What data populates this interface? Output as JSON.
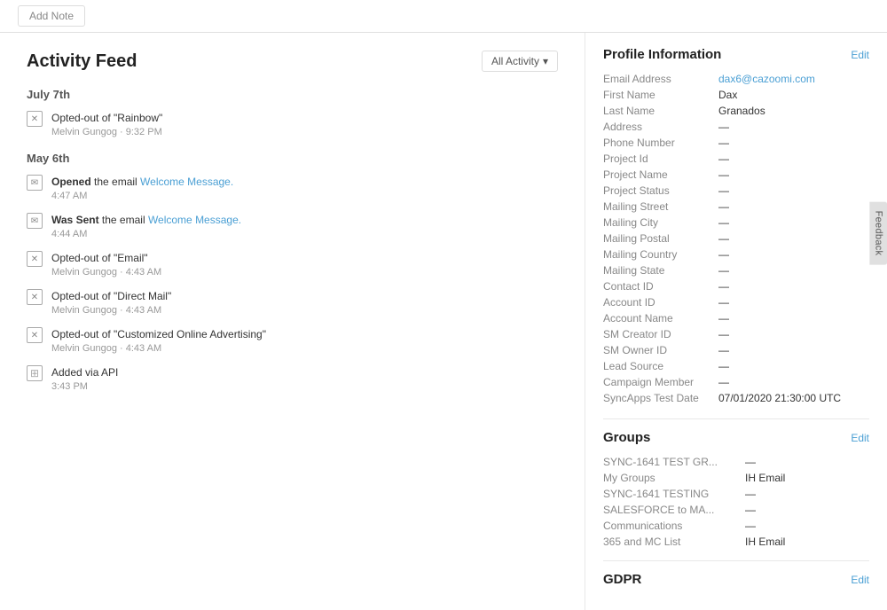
{
  "topbar": {
    "add_note_label": "Add Note"
  },
  "activity": {
    "title": "Activity Feed",
    "filter_label": "All Activity",
    "sections": [
      {
        "date": "July 7th",
        "items": [
          {
            "icon": "x",
            "text_parts": [
              {
                "type": "plain",
                "text": "Opted-out of \"Rainbow\""
              }
            ],
            "meta": "Melvin Gungog · 9:32 PM"
          }
        ]
      },
      {
        "date": "May 6th",
        "items": [
          {
            "icon": "envelope",
            "text_parts": [
              {
                "type": "bold",
                "text": "Opened"
              },
              {
                "type": "plain",
                "text": " the email "
              },
              {
                "type": "link",
                "text": "Welcome Message."
              }
            ],
            "meta": "4:47 AM"
          },
          {
            "icon": "envelope",
            "text_parts": [
              {
                "type": "bold",
                "text": "Was Sent"
              },
              {
                "type": "plain",
                "text": " the email "
              },
              {
                "type": "link",
                "text": "Welcome Message."
              }
            ],
            "meta": "4:44 AM"
          },
          {
            "icon": "x",
            "text_parts": [
              {
                "type": "plain",
                "text": "Opted-out of \"Email\""
              }
            ],
            "meta": "Melvin Gungog · 4:43 AM"
          },
          {
            "icon": "x",
            "text_parts": [
              {
                "type": "plain",
                "text": "Opted-out of \"Direct Mail\""
              }
            ],
            "meta": "Melvin Gungog · 4:43 AM"
          },
          {
            "icon": "x",
            "text_parts": [
              {
                "type": "plain",
                "text": "Opted-out of \"Customized Online Advertising\""
              }
            ],
            "meta": "Melvin Gungog · 4:43 AM"
          },
          {
            "icon": "plus",
            "text_parts": [
              {
                "type": "plain",
                "text": "Added via API"
              }
            ],
            "meta": "3:43 PM"
          }
        ]
      }
    ]
  },
  "profile": {
    "section_title": "Profile Information",
    "edit_label": "Edit",
    "fields": [
      {
        "label": "Email Address",
        "value": "dax6@cazoomi.com",
        "type": "email"
      },
      {
        "label": "First Name",
        "value": "Dax",
        "type": "text"
      },
      {
        "label": "Last Name",
        "value": "Granados",
        "type": "text"
      },
      {
        "label": "Address",
        "value": "—",
        "type": "dash"
      },
      {
        "label": "Phone Number",
        "value": "—",
        "type": "dash"
      },
      {
        "label": "Project Id",
        "value": "—",
        "type": "dash"
      },
      {
        "label": "Project Name",
        "value": "—",
        "type": "dash"
      },
      {
        "label": "Project Status",
        "value": "—",
        "type": "dash"
      },
      {
        "label": "Mailing Street",
        "value": "—",
        "type": "dash"
      },
      {
        "label": "Mailing City",
        "value": "—",
        "type": "dash"
      },
      {
        "label": "Mailing Postal",
        "value": "—",
        "type": "dash"
      },
      {
        "label": "Mailing Country",
        "value": "—",
        "type": "dash"
      },
      {
        "label": "Mailing State",
        "value": "—",
        "type": "dash"
      },
      {
        "label": "Contact ID",
        "value": "—",
        "type": "dash"
      },
      {
        "label": "Account ID",
        "value": "—",
        "type": "dash"
      },
      {
        "label": "Account Name",
        "value": "—",
        "type": "dash"
      },
      {
        "label": "SM Creator ID",
        "value": "—",
        "type": "dash"
      },
      {
        "label": "SM Owner ID",
        "value": "—",
        "type": "dash"
      },
      {
        "label": "Lead Source",
        "value": "—",
        "type": "dash"
      },
      {
        "label": "Campaign Member",
        "value": "—",
        "type": "dash"
      },
      {
        "label": "SyncApps Test Date",
        "value": "07/01/2020 21:30:00 UTC",
        "type": "text"
      }
    ]
  },
  "groups": {
    "section_title": "Groups",
    "edit_label": "Edit",
    "rows": [
      {
        "group": "SYNC-1641 TEST GR...",
        "value": "—",
        "type": "dash"
      },
      {
        "group": "My Groups",
        "value": "IH Email",
        "type": "text"
      },
      {
        "group": "SYNC-1641 TESTING",
        "value": "—",
        "type": "dash"
      },
      {
        "group": "SALESFORCE to MA...",
        "value": "—",
        "type": "dash"
      },
      {
        "group": "Communications",
        "value": "—",
        "type": "dash"
      },
      {
        "group": "365 and MC List",
        "value": "IH Email",
        "type": "text"
      }
    ]
  },
  "gdpr": {
    "section_title": "GDPR",
    "edit_label": "Edit"
  },
  "feedback": {
    "label": "Feedback"
  }
}
